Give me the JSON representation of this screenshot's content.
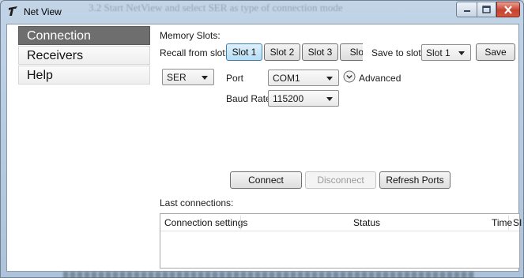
{
  "window": {
    "title": "Net View",
    "background_text": "3.2 Start NetView and select SER as type of connection mode"
  },
  "nav": {
    "items": [
      {
        "label": "Connection",
        "active": true
      },
      {
        "label": "Receivers",
        "active": false
      },
      {
        "label": "Help",
        "active": false
      }
    ]
  },
  "memory": {
    "label": "Memory Slots:",
    "recall_label": "Recall from slot:",
    "slots": [
      "Slot 1",
      "Slot 2",
      "Slot 3",
      "Slot"
    ],
    "active_slot": "Slot 1",
    "save_to_label": "Save to slot:",
    "save_slot_value": "Slot 1",
    "save_label": "Save"
  },
  "connection": {
    "type_value": "SER",
    "port_label": "Port",
    "port_value": "COM1",
    "advanced_label": "Advanced",
    "baud_label": "Baud Rate",
    "baud_value": "115200"
  },
  "actions": {
    "connect": "Connect",
    "disconnect": "Disconnect",
    "refresh": "Refresh Ports"
  },
  "last_connections": {
    "label": "Last connections:",
    "columns": [
      "Connection settings",
      "Status",
      "Time",
      "SI"
    ]
  },
  "colors": {
    "nav_active": "#6e6e6e",
    "slot_active": "#b5dcf5",
    "close_button": "#c7432f"
  }
}
